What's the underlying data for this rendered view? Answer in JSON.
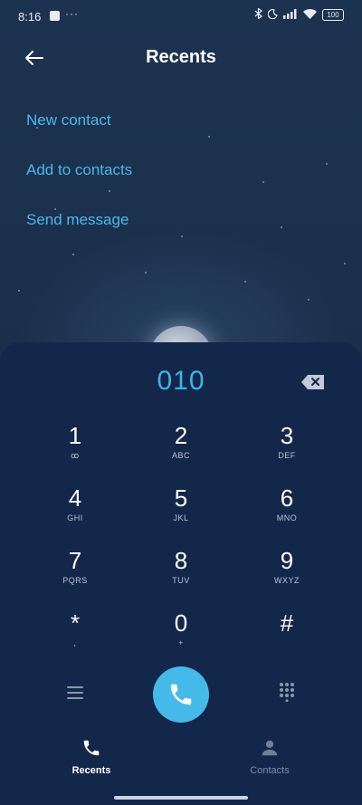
{
  "status_bar": {
    "time": "8:16",
    "more": "···",
    "battery": "100"
  },
  "header": {
    "title": "Recents",
    "back_icon": "arrow-left-icon"
  },
  "options": [
    {
      "label": "New contact"
    },
    {
      "label": "Add to contacts"
    },
    {
      "label": "Send message"
    }
  ],
  "dialer": {
    "number": "010",
    "keys": [
      {
        "digit": "1",
        "letters": "ꝏ"
      },
      {
        "digit": "2",
        "letters": "ABC"
      },
      {
        "digit": "3",
        "letters": "DEF"
      },
      {
        "digit": "4",
        "letters": "GHI"
      },
      {
        "digit": "5",
        "letters": "JKL"
      },
      {
        "digit": "6",
        "letters": "MNO"
      },
      {
        "digit": "7",
        "letters": "PQRS"
      },
      {
        "digit": "8",
        "letters": "TUV"
      },
      {
        "digit": "9",
        "letters": "WXYZ"
      },
      {
        "digit": "*",
        "letters": ","
      },
      {
        "digit": "0",
        "letters": "+"
      },
      {
        "digit": "#",
        "letters": ""
      }
    ]
  },
  "nav": {
    "recents": "Recents",
    "contacts": "Contacts"
  },
  "colors": {
    "accent": "#45b9e8",
    "background": "#1a2b45",
    "panel": "#13274a"
  }
}
